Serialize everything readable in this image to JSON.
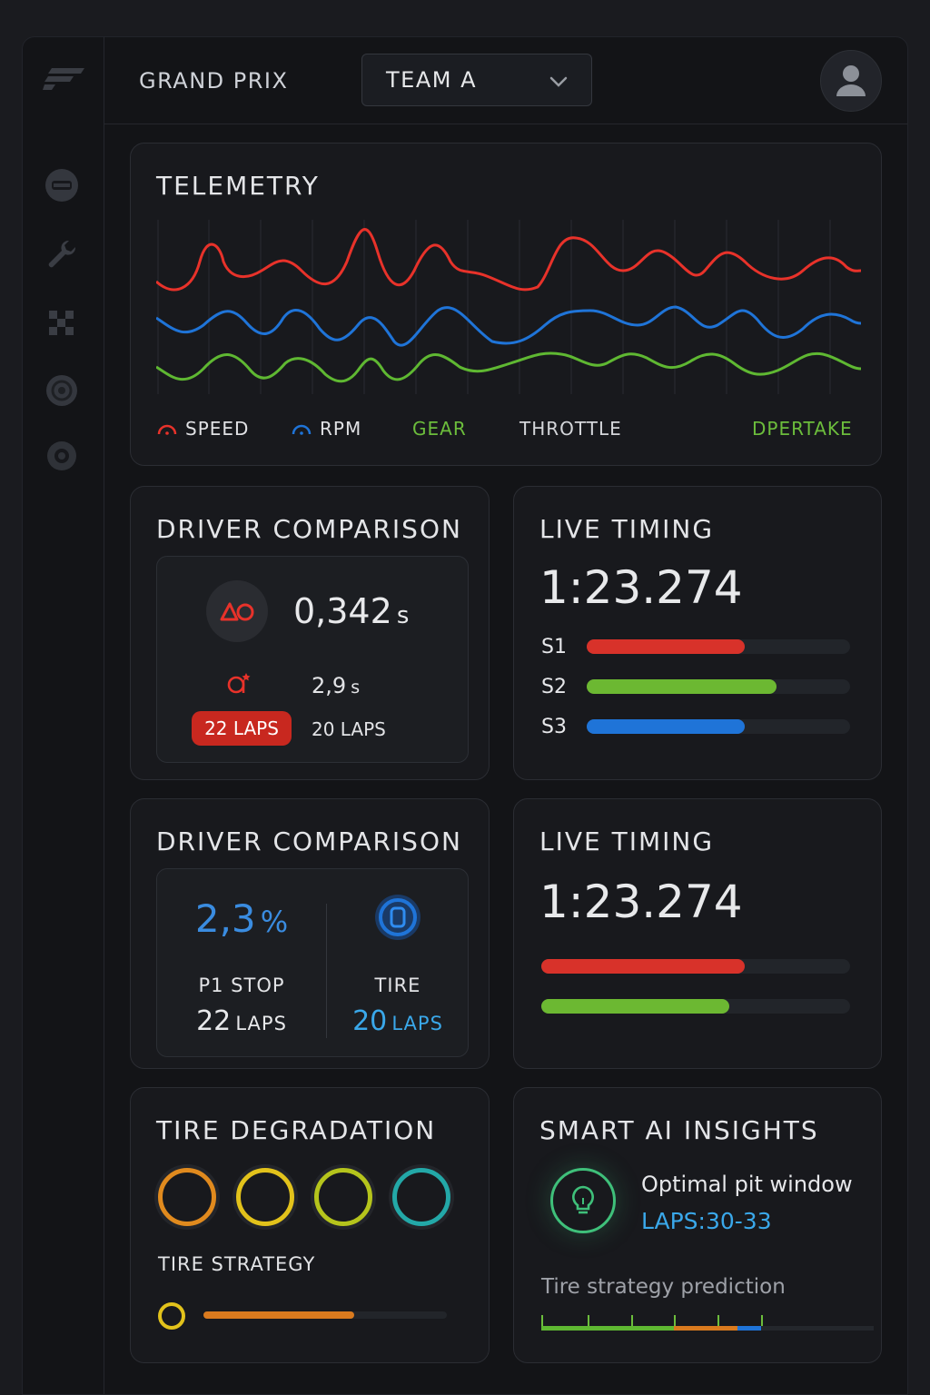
{
  "header": {
    "brand": "GRAND PRIX",
    "team_selected": "TEAM A"
  },
  "sidebar": {
    "icons": [
      "tire-icon",
      "wrench-icon",
      "checkered-flag-icon",
      "brake-disc-icon",
      "wheel-icon"
    ]
  },
  "telemetry": {
    "title": "TELEMETRY",
    "legend": {
      "speed": "SPEED",
      "rpm": "RPM",
      "gear": "GEAR",
      "throttle": "THROTTLE",
      "overtake": "DPERTAKE"
    },
    "colors": {
      "speed": "#e8322a",
      "rpm": "#1f74d8",
      "gear": "#5fb832"
    }
  },
  "driver_comparison_1": {
    "title": "DRIVER COMPARISON",
    "gap_value": "0,342",
    "gap_unit": "s",
    "delta_value": "2,9",
    "delta_unit": "s",
    "laps_a": "22 LAPS",
    "laps_b": "20 LAPS"
  },
  "live_timing_1": {
    "title": "LIVE TIMING",
    "lap_time": "1:23.274",
    "sectors": [
      {
        "label": "S1",
        "fill": 0.6,
        "color": "#d8322a"
      },
      {
        "label": "S2",
        "fill": 0.72,
        "color": "#6cb832"
      },
      {
        "label": "S3",
        "fill": 0.6,
        "color": "#1f74d8"
      }
    ]
  },
  "driver_comparison_2": {
    "title": "DRIVER COMPARISON",
    "percent_value": "2,3",
    "percent_unit": "%",
    "left_label": "P1 STOP",
    "left_laps_num": "22",
    "left_laps_unit": "LAPS",
    "right_label": "TIRE",
    "right_laps_num": "20",
    "right_laps_unit": "LAPS"
  },
  "live_timing_2": {
    "title": "LIVE TIMING",
    "lap_time": "1:23.274",
    "bars": [
      {
        "fill": 0.66,
        "color": "#d8322a"
      },
      {
        "fill": 0.61,
        "color": "#6cb832"
      }
    ]
  },
  "tire_degradation": {
    "title": "TIRE DEGRADATION",
    "rings": [
      "#e08a1e",
      "#e2c21b",
      "#b5c41c",
      "#23a8a8"
    ],
    "strategy_label": "TIRE STRATEGY",
    "strategy_fill": 0.62,
    "strategy_color": "#d97a1e",
    "strategy_dot_color": "#e2c21b"
  },
  "ai_insights": {
    "title": "SMART AI INSIGHTS",
    "insight": "Optimal pit window",
    "laps": "LAPS:30-33",
    "prediction_label": "Tire strategy prediction",
    "prediction_segments": [
      {
        "fill": 0.4,
        "color": "#5fb832"
      },
      {
        "fill": 0.19,
        "color": "#d97a1e"
      },
      {
        "fill": 0.07,
        "color": "#1f74d8"
      }
    ]
  }
}
